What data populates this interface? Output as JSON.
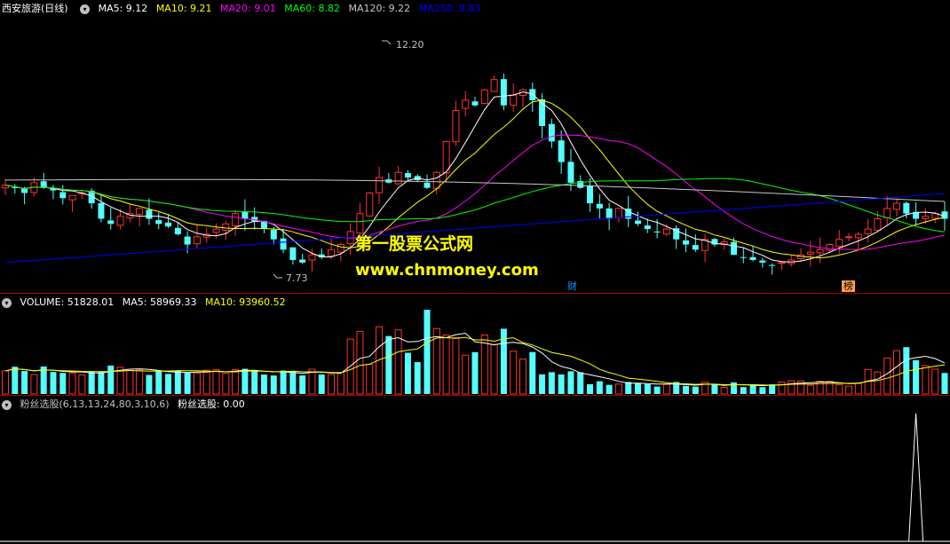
{
  "price": {
    "stock_name": "西安旅游(日线)",
    "ma": [
      {
        "label": "MA5: 9.12",
        "color": "#ffffff"
      },
      {
        "label": "MA10: 9.21",
        "color": "#ffff00"
      },
      {
        "label": "MA20: 9.01",
        "color": "#ff00ff"
      },
      {
        "label": "MA60: 8.82",
        "color": "#00ff00"
      },
      {
        "label": "MA120: 9.22",
        "color": "#c8c8c8"
      },
      {
        "label": "MA250: 9.83",
        "color": "#0000ff"
      }
    ],
    "high_label": "12.20",
    "low_label": "7.73",
    "tag_cai": "财",
    "tag_bang": "榜"
  },
  "watermark": {
    "line1": "第一股票公式网",
    "line2": "www.chnmoney.com"
  },
  "volume": {
    "items": [
      {
        "label": "VOLUME: 51828.01",
        "color": "#ffffff"
      },
      {
        "label": "MA5: 58969.33",
        "color": "#ffffff"
      },
      {
        "label": "MA10: 93960.52",
        "color": "#ffff00"
      }
    ]
  },
  "indicator": {
    "title": "粉丝选股(6,13,13,24,80,3,10,6)",
    "value_label": "粉丝选股: 0.00"
  },
  "colors": {
    "up": "#ff3232",
    "down": "#54ffff",
    "axis": "#a00000"
  },
  "chart_data": {
    "type": "candlestick",
    "closes": [
      9.35,
      9.3,
      9.2,
      9.4,
      9.3,
      9.25,
      9.1,
      9.15,
      9.2,
      9.0,
      8.7,
      8.6,
      8.75,
      8.8,
      8.9,
      8.7,
      8.6,
      8.55,
      8.4,
      8.2,
      8.35,
      8.4,
      8.5,
      8.6,
      8.8,
      8.7,
      8.65,
      8.5,
      8.3,
      8.1,
      7.9,
      7.85,
      8.0,
      7.95,
      8.1,
      8.2,
      8.45,
      8.8,
      9.2,
      9.5,
      9.4,
      9.6,
      9.5,
      9.45,
      9.3,
      9.6,
      10.2,
      10.8,
      11.0,
      10.9,
      11.2,
      11.4,
      10.9,
      11.1,
      11.2,
      11.0,
      10.5,
      10.2,
      9.8,
      9.4,
      9.3,
      9.0,
      8.9,
      8.7,
      8.9,
      8.7,
      8.6,
      8.5,
      8.45,
      8.5,
      8.3,
      8.2,
      8.1,
      8.3,
      8.2,
      8.25,
      8.0,
      7.95,
      7.9,
      7.85,
      7.8,
      7.85,
      7.9,
      8.0,
      8.05,
      8.1,
      8.2,
      8.3,
      8.35,
      8.4,
      8.5,
      8.7,
      8.9,
      9.0,
      8.8,
      8.7,
      8.75,
      8.8,
      8.7
    ],
    "volume_ma_labels": [
      "VOLUME",
      "MA5",
      "MA10"
    ],
    "signal_spike_index": 95
  }
}
